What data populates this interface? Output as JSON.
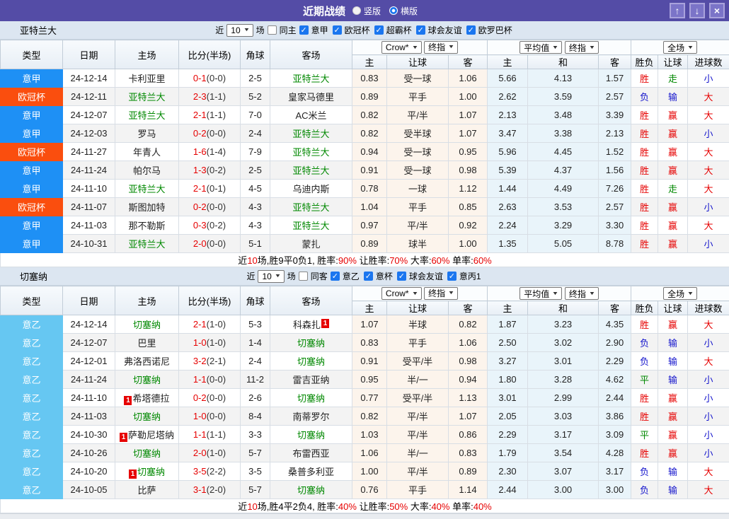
{
  "titlebar": {
    "title": "近期战绩",
    "vertical_label": "竖版",
    "horizontal_label": "横版"
  },
  "colors": {
    "titlebar_bg": "#544CA6",
    "league_blue": "#1E90F5",
    "league_orange": "#FA4E0E",
    "league_lightblue": "#66C7F2",
    "win_red": "#E60000",
    "lose_blue": "#1414CC",
    "draw_green": "#008800"
  },
  "sections": [
    {
      "team": "亚特兰大",
      "filter": {
        "near_label": "近",
        "count": "10",
        "games_label": "场",
        "same_label": "同主",
        "same_checked": false,
        "leagues": [
          "意甲",
          "欧冠杯",
          "超霸杯",
          "球会友谊",
          "欧罗巴杯"
        ]
      },
      "header": {
        "cols": [
          "类型",
          "日期",
          "主场",
          "比分(半场)",
          "角球",
          "客场"
        ],
        "odds_select": "Crow*",
        "final_select": "终指",
        "avg_select": "平均值",
        "final_select2": "终指",
        "fulltime_select": "全场",
        "sub": [
          "主",
          "让球",
          "客",
          "主",
          "和",
          "客",
          "胜负",
          "让球",
          "进球数"
        ]
      },
      "rows": [
        {
          "league": "意甲",
          "lc": "blue",
          "date": "24-12-14",
          "home": {
            "n": "卡利亚里"
          },
          "score": "0-1",
          "half": "(0-0)",
          "corner": "2-5",
          "away": {
            "n": "亚特兰大",
            "g": true
          },
          "odds": [
            "0.83",
            "受一球",
            "1.06"
          ],
          "avg": [
            "5.66",
            "4.13",
            "1.57"
          ],
          "res": [
            [
              "胜",
              "r"
            ],
            [
              "走",
              "g"
            ],
            [
              "小",
              "b"
            ]
          ]
        },
        {
          "league": "欧冠杯",
          "lc": "orange",
          "date": "24-12-11",
          "home": {
            "n": "亚特兰大",
            "g": true
          },
          "score": "2-3",
          "half": "(1-1)",
          "corner": "5-2",
          "away": {
            "n": "皇家马德里"
          },
          "odds": [
            "0.89",
            "平手",
            "1.00"
          ],
          "avg": [
            "2.62",
            "3.59",
            "2.57"
          ],
          "res": [
            [
              "负",
              "b"
            ],
            [
              "输",
              "b"
            ],
            [
              "大",
              "r"
            ]
          ]
        },
        {
          "league": "意甲",
          "lc": "blue",
          "date": "24-12-07",
          "home": {
            "n": "亚特兰大",
            "g": true
          },
          "score": "2-1",
          "half": "(1-1)",
          "corner": "7-0",
          "away": {
            "n": "AC米兰"
          },
          "odds": [
            "0.82",
            "平/半",
            "1.07"
          ],
          "avg": [
            "2.13",
            "3.48",
            "3.39"
          ],
          "res": [
            [
              "胜",
              "r"
            ],
            [
              "赢",
              "r"
            ],
            [
              "大",
              "r"
            ]
          ]
        },
        {
          "league": "意甲",
          "lc": "blue",
          "date": "24-12-03",
          "home": {
            "n": "罗马"
          },
          "score": "0-2",
          "half": "(0-0)",
          "corner": "2-4",
          "away": {
            "n": "亚特兰大",
            "g": true
          },
          "odds": [
            "0.82",
            "受半球",
            "1.07"
          ],
          "avg": [
            "3.47",
            "3.38",
            "2.13"
          ],
          "res": [
            [
              "胜",
              "r"
            ],
            [
              "赢",
              "r"
            ],
            [
              "小",
              "b"
            ]
          ]
        },
        {
          "league": "欧冠杯",
          "lc": "orange",
          "date": "24-11-27",
          "home": {
            "n": "年青人"
          },
          "score": "1-6",
          "half": "(1-4)",
          "corner": "7-9",
          "away": {
            "n": "亚特兰大",
            "g": true
          },
          "odds": [
            "0.94",
            "受一球",
            "0.95"
          ],
          "avg": [
            "5.96",
            "4.45",
            "1.52"
          ],
          "res": [
            [
              "胜",
              "r"
            ],
            [
              "赢",
              "r"
            ],
            [
              "大",
              "r"
            ]
          ]
        },
        {
          "league": "意甲",
          "lc": "blue",
          "date": "24-11-24",
          "home": {
            "n": "帕尔马"
          },
          "score": "1-3",
          "half": "(0-2)",
          "corner": "2-5",
          "away": {
            "n": "亚特兰大",
            "g": true
          },
          "odds": [
            "0.91",
            "受一球",
            "0.98"
          ],
          "avg": [
            "5.39",
            "4.37",
            "1.56"
          ],
          "res": [
            [
              "胜",
              "r"
            ],
            [
              "赢",
              "r"
            ],
            [
              "大",
              "r"
            ]
          ]
        },
        {
          "league": "意甲",
          "lc": "blue",
          "date": "24-11-10",
          "home": {
            "n": "亚特兰大",
            "g": true
          },
          "score": "2-1",
          "half": "(0-1)",
          "corner": "4-5",
          "away": {
            "n": "乌迪内斯"
          },
          "odds": [
            "0.78",
            "一球",
            "1.12"
          ],
          "avg": [
            "1.44",
            "4.49",
            "7.26"
          ],
          "res": [
            [
              "胜",
              "r"
            ],
            [
              "走",
              "g"
            ],
            [
              "大",
              "r"
            ]
          ]
        },
        {
          "league": "欧冠杯",
          "lc": "orange",
          "date": "24-11-07",
          "home": {
            "n": "斯图加特"
          },
          "score": "0-2",
          "half": "(0-0)",
          "corner": "4-3",
          "away": {
            "n": "亚特兰大",
            "g": true
          },
          "odds": [
            "1.04",
            "平手",
            "0.85"
          ],
          "avg": [
            "2.63",
            "3.53",
            "2.57"
          ],
          "res": [
            [
              "胜",
              "r"
            ],
            [
              "赢",
              "r"
            ],
            [
              "小",
              "b"
            ]
          ]
        },
        {
          "league": "意甲",
          "lc": "blue",
          "date": "24-11-03",
          "home": {
            "n": "那不勒斯"
          },
          "score": "0-3",
          "half": "(0-2)",
          "corner": "4-3",
          "away": {
            "n": "亚特兰大",
            "g": true
          },
          "odds": [
            "0.97",
            "平/半",
            "0.92"
          ],
          "avg": [
            "2.24",
            "3.29",
            "3.30"
          ],
          "res": [
            [
              "胜",
              "r"
            ],
            [
              "赢",
              "r"
            ],
            [
              "大",
              "r"
            ]
          ]
        },
        {
          "league": "意甲",
          "lc": "blue",
          "date": "24-10-31",
          "home": {
            "n": "亚特兰大",
            "g": true
          },
          "score": "2-0",
          "half": "(0-0)",
          "corner": "5-1",
          "away": {
            "n": "蒙扎"
          },
          "odds": [
            "0.89",
            "球半",
            "1.00"
          ],
          "avg": [
            "1.35",
            "5.05",
            "8.78"
          ],
          "res": [
            [
              "胜",
              "r"
            ],
            [
              "赢",
              "r"
            ],
            [
              "小",
              "b"
            ]
          ]
        }
      ],
      "summary": [
        {
          "t": "近"
        },
        {
          "t": "10",
          "r": true
        },
        {
          "t": "场,胜9平0负1, 胜率:"
        },
        {
          "t": "90%",
          "r": true
        },
        {
          "t": " 让胜率:"
        },
        {
          "t": "70%",
          "r": true
        },
        {
          "t": " 大率:"
        },
        {
          "t": "60%",
          "r": true
        },
        {
          "t": " 单率:"
        },
        {
          "t": "60%",
          "r": true
        }
      ]
    },
    {
      "team": "切塞纳",
      "filter": {
        "near_label": "近",
        "count": "10",
        "games_label": "场",
        "same_label": "同客",
        "same_checked": false,
        "leagues": [
          "意乙",
          "意杯",
          "球会友谊",
          "意丙1"
        ]
      },
      "header": {
        "cols": [
          "类型",
          "日期",
          "主场",
          "比分(半场)",
          "角球",
          "客场"
        ],
        "odds_select": "Crow*",
        "final_select": "终指",
        "avg_select": "平均值",
        "final_select2": "终指",
        "fulltime_select": "全场",
        "sub": [
          "主",
          "让球",
          "客",
          "主",
          "和",
          "客",
          "胜负",
          "让球",
          "进球数"
        ]
      },
      "rows": [
        {
          "league": "意乙",
          "lc": "lightblue",
          "date": "24-12-14",
          "home": {
            "n": "切塞纳",
            "g": true
          },
          "score": "2-1",
          "half": "(1-0)",
          "corner": "5-3",
          "away": {
            "n": "科森扎",
            "ca": "1"
          },
          "odds": [
            "1.07",
            "半球",
            "0.82"
          ],
          "avg": [
            "1.87",
            "3.23",
            "4.35"
          ],
          "res": [
            [
              "胜",
              "r"
            ],
            [
              "赢",
              "r"
            ],
            [
              "大",
              "r"
            ]
          ]
        },
        {
          "league": "意乙",
          "lc": "lightblue",
          "date": "24-12-07",
          "home": {
            "n": "巴里"
          },
          "score": "1-0",
          "half": "(1-0)",
          "corner": "1-4",
          "away": {
            "n": "切塞纳",
            "g": true
          },
          "odds": [
            "0.83",
            "平手",
            "1.06"
          ],
          "avg": [
            "2.50",
            "3.02",
            "2.90"
          ],
          "res": [
            [
              "负",
              "b"
            ],
            [
              "输",
              "b"
            ],
            [
              "小",
              "b"
            ]
          ]
        },
        {
          "league": "意乙",
          "lc": "lightblue",
          "date": "24-12-01",
          "home": {
            "n": "弗洛西诺尼"
          },
          "score": "3-2",
          "half": "(2-1)",
          "corner": "2-4",
          "away": {
            "n": "切塞纳",
            "g": true
          },
          "odds": [
            "0.91",
            "受平/半",
            "0.98"
          ],
          "avg": [
            "3.27",
            "3.01",
            "2.29"
          ],
          "res": [
            [
              "负",
              "b"
            ],
            [
              "输",
              "b"
            ],
            [
              "大",
              "r"
            ]
          ]
        },
        {
          "league": "意乙",
          "lc": "lightblue",
          "date": "24-11-24",
          "home": {
            "n": "切塞纳",
            "g": true
          },
          "score": "1-1",
          "half": "(0-0)",
          "corner": "11-2",
          "away": {
            "n": "雷吉亚纳"
          },
          "odds": [
            "0.95",
            "半/一",
            "0.94"
          ],
          "avg": [
            "1.80",
            "3.28",
            "4.62"
          ],
          "res": [
            [
              "平",
              "g"
            ],
            [
              "输",
              "b"
            ],
            [
              "小",
              "b"
            ]
          ]
        },
        {
          "league": "意乙",
          "lc": "lightblue",
          "date": "24-11-10",
          "home": {
            "n": "希塔德拉",
            "cb": "1"
          },
          "score": "0-2",
          "half": "(0-0)",
          "corner": "2-6",
          "away": {
            "n": "切塞纳",
            "g": true
          },
          "odds": [
            "0.77",
            "受平/半",
            "1.13"
          ],
          "avg": [
            "3.01",
            "2.99",
            "2.44"
          ],
          "res": [
            [
              "胜",
              "r"
            ],
            [
              "赢",
              "r"
            ],
            [
              "小",
              "b"
            ]
          ]
        },
        {
          "league": "意乙",
          "lc": "lightblue",
          "date": "24-11-03",
          "home": {
            "n": "切塞纳",
            "g": true
          },
          "score": "1-0",
          "half": "(0-0)",
          "corner": "8-4",
          "away": {
            "n": "南蒂罗尔"
          },
          "odds": [
            "0.82",
            "平/半",
            "1.07"
          ],
          "avg": [
            "2.05",
            "3.03",
            "3.86"
          ],
          "res": [
            [
              "胜",
              "r"
            ],
            [
              "赢",
              "r"
            ],
            [
              "小",
              "b"
            ]
          ]
        },
        {
          "league": "意乙",
          "lc": "lightblue",
          "date": "24-10-30",
          "home": {
            "n": "萨勒尼塔纳",
            "cb": "1"
          },
          "score": "1-1",
          "half": "(1-1)",
          "corner": "3-3",
          "away": {
            "n": "切塞纳",
            "g": true
          },
          "odds": [
            "1.03",
            "平/半",
            "0.86"
          ],
          "avg": [
            "2.29",
            "3.17",
            "3.09"
          ],
          "res": [
            [
              "平",
              "g"
            ],
            [
              "赢",
              "r"
            ],
            [
              "小",
              "b"
            ]
          ]
        },
        {
          "league": "意乙",
          "lc": "lightblue",
          "date": "24-10-26",
          "home": {
            "n": "切塞纳",
            "g": true
          },
          "score": "2-0",
          "half": "(1-0)",
          "corner": "5-7",
          "away": {
            "n": "布雷西亚"
          },
          "odds": [
            "1.06",
            "半/一",
            "0.83"
          ],
          "avg": [
            "1.79",
            "3.54",
            "4.28"
          ],
          "res": [
            [
              "胜",
              "r"
            ],
            [
              "赢",
              "r"
            ],
            [
              "小",
              "b"
            ]
          ]
        },
        {
          "league": "意乙",
          "lc": "lightblue",
          "date": "24-10-20",
          "home": {
            "n": "切塞纳",
            "g": true,
            "cb": "1"
          },
          "score": "3-5",
          "half": "(2-2)",
          "corner": "3-5",
          "away": {
            "n": "桑普多利亚"
          },
          "odds": [
            "1.00",
            "平/半",
            "0.89"
          ],
          "avg": [
            "2.30",
            "3.07",
            "3.17"
          ],
          "res": [
            [
              "负",
              "b"
            ],
            [
              "输",
              "b"
            ],
            [
              "大",
              "r"
            ]
          ]
        },
        {
          "league": "意乙",
          "lc": "lightblue",
          "date": "24-10-05",
          "home": {
            "n": "比萨"
          },
          "score": "3-1",
          "half": "(2-0)",
          "corner": "5-7",
          "away": {
            "n": "切塞纳",
            "g": true
          },
          "odds": [
            "0.76",
            "平手",
            "1.14"
          ],
          "avg": [
            "2.44",
            "3.00",
            "3.00"
          ],
          "res": [
            [
              "负",
              "b"
            ],
            [
              "输",
              "b"
            ],
            [
              "大",
              "r"
            ]
          ]
        }
      ],
      "summary": [
        {
          "t": "近"
        },
        {
          "t": "10",
          "r": true
        },
        {
          "t": "场,胜4平2负4, 胜率:"
        },
        {
          "t": "40%",
          "r": true
        },
        {
          "t": " 让胜率:"
        },
        {
          "t": "50%",
          "r": true
        },
        {
          "t": " 大率:"
        },
        {
          "t": "40%",
          "r": true
        },
        {
          "t": " 单率:"
        },
        {
          "t": "40%",
          "r": true
        }
      ]
    }
  ]
}
